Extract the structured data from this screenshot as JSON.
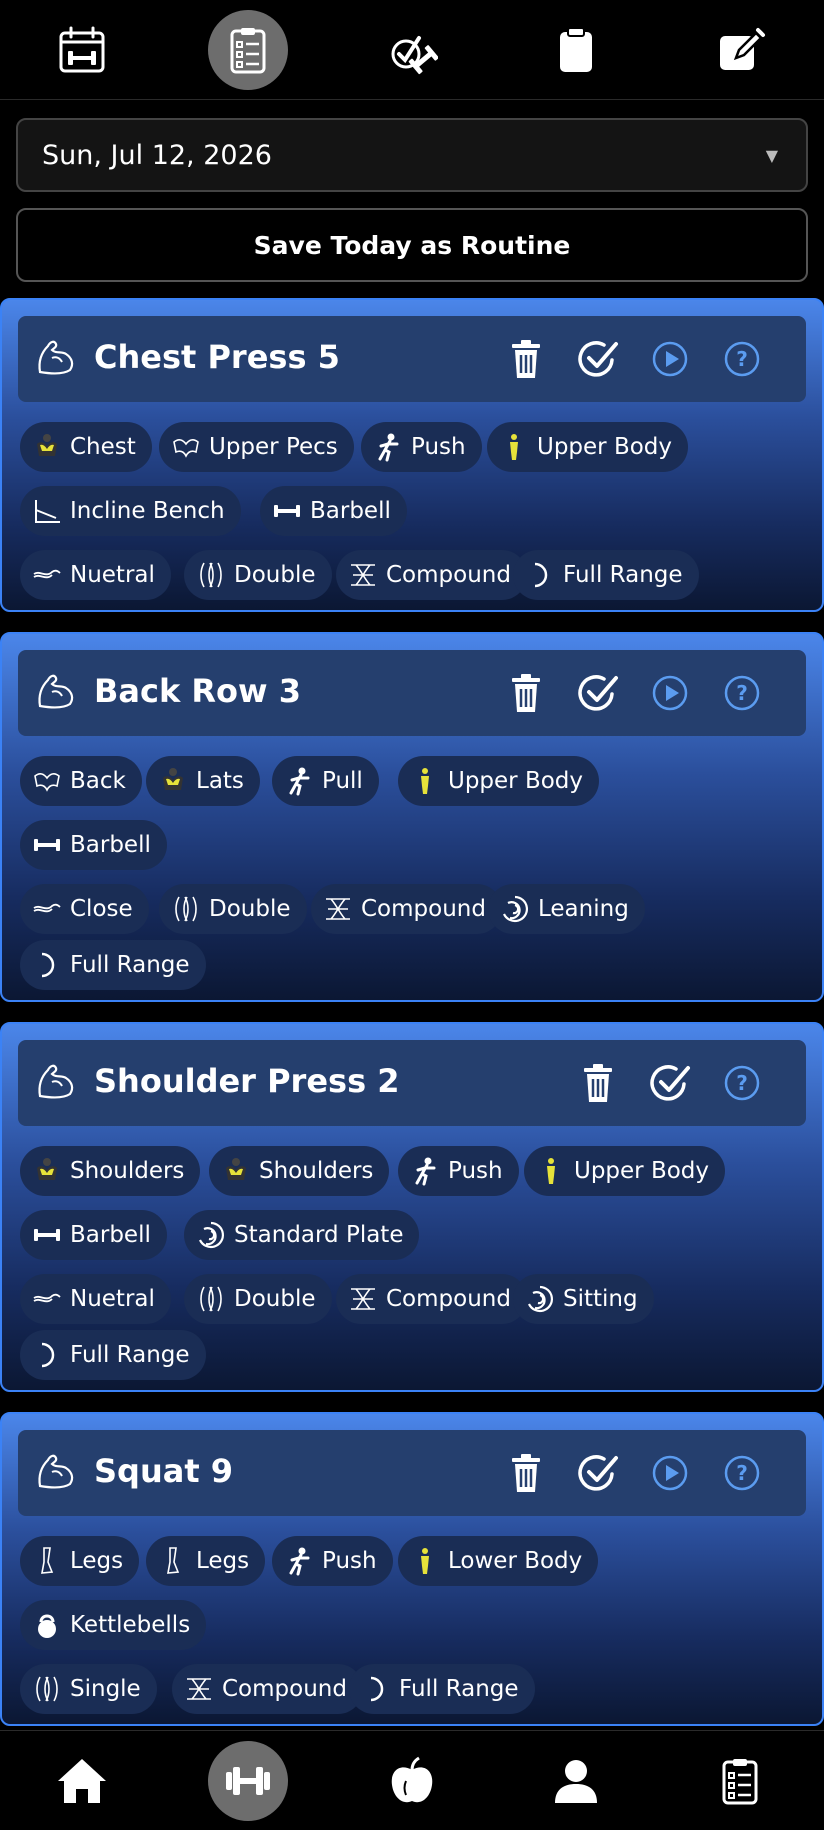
{
  "top_nav": [
    {
      "icon": "calendar-icon",
      "label": "Calendar",
      "active": false
    },
    {
      "icon": "clipboard-list-icon",
      "label": "Routine",
      "active": true
    },
    {
      "icon": "dumbbell-check-icon",
      "label": "Workouts",
      "active": false
    },
    {
      "icon": "clipboard-icon",
      "label": "Logs",
      "active": false
    },
    {
      "icon": "edit-icon",
      "label": "Edit",
      "active": false
    }
  ],
  "date_select": {
    "value": "Sun, Jul 12, 2026"
  },
  "save_routine": {
    "label": "Save Today as Routine"
  },
  "exercises": [
    {
      "title": "Chest Press 5",
      "actions": [
        "delete",
        "complete",
        "play",
        "help"
      ],
      "tags": [
        [
          "Chest",
          "Upper Pecs",
          "Push",
          "Upper Body"
        ],
        [
          "Incline Bench",
          "Barbell"
        ],
        [
          "Nuetral",
          "Double",
          "Compound",
          "Full Range"
        ]
      ]
    },
    {
      "title": "Back Row 3",
      "actions": [
        "delete",
        "complete",
        "play",
        "help"
      ],
      "tags": [
        [
          "Back",
          "Lats",
          "Pull",
          "Upper Body"
        ],
        [
          "Barbell"
        ],
        [
          "Close",
          "Double",
          "Compound",
          "Leaning"
        ],
        [
          "Full Range"
        ]
      ]
    },
    {
      "title": "Shoulder Press 2",
      "actions": [
        "delete",
        "complete",
        "help"
      ],
      "tags": [
        [
          "Shoulders",
          "Shoulders",
          "Push",
          "Upper Body"
        ],
        [
          "Barbell",
          "Standard Plate"
        ],
        [
          "Nuetral",
          "Double",
          "Compound",
          "Sitting"
        ],
        [
          "Full Range"
        ]
      ]
    },
    {
      "title": "Squat 9",
      "actions": [
        "delete",
        "complete",
        "play",
        "help"
      ],
      "tags": [
        [
          "Legs",
          "Legs",
          "Push",
          "Lower Body"
        ],
        [
          "Kettlebells"
        ],
        [
          "Single",
          "Compound",
          "Full Range"
        ]
      ]
    }
  ],
  "bottom_nav": [
    {
      "icon": "home-icon",
      "label": "Home",
      "active": false
    },
    {
      "icon": "dumbbell-icon",
      "label": "Workout",
      "active": true
    },
    {
      "icon": "apple-icon",
      "label": "Nutrition",
      "active": false
    },
    {
      "icon": "user-icon",
      "label": "Profile",
      "active": false
    },
    {
      "icon": "clipboard-list-icon",
      "label": "Plans",
      "active": false
    }
  ],
  "colors": {
    "accent": "#3b82f6",
    "card_header": "#253f6e",
    "tag_bg": "#1a2d55",
    "action_blue": "#5b9cf0"
  }
}
